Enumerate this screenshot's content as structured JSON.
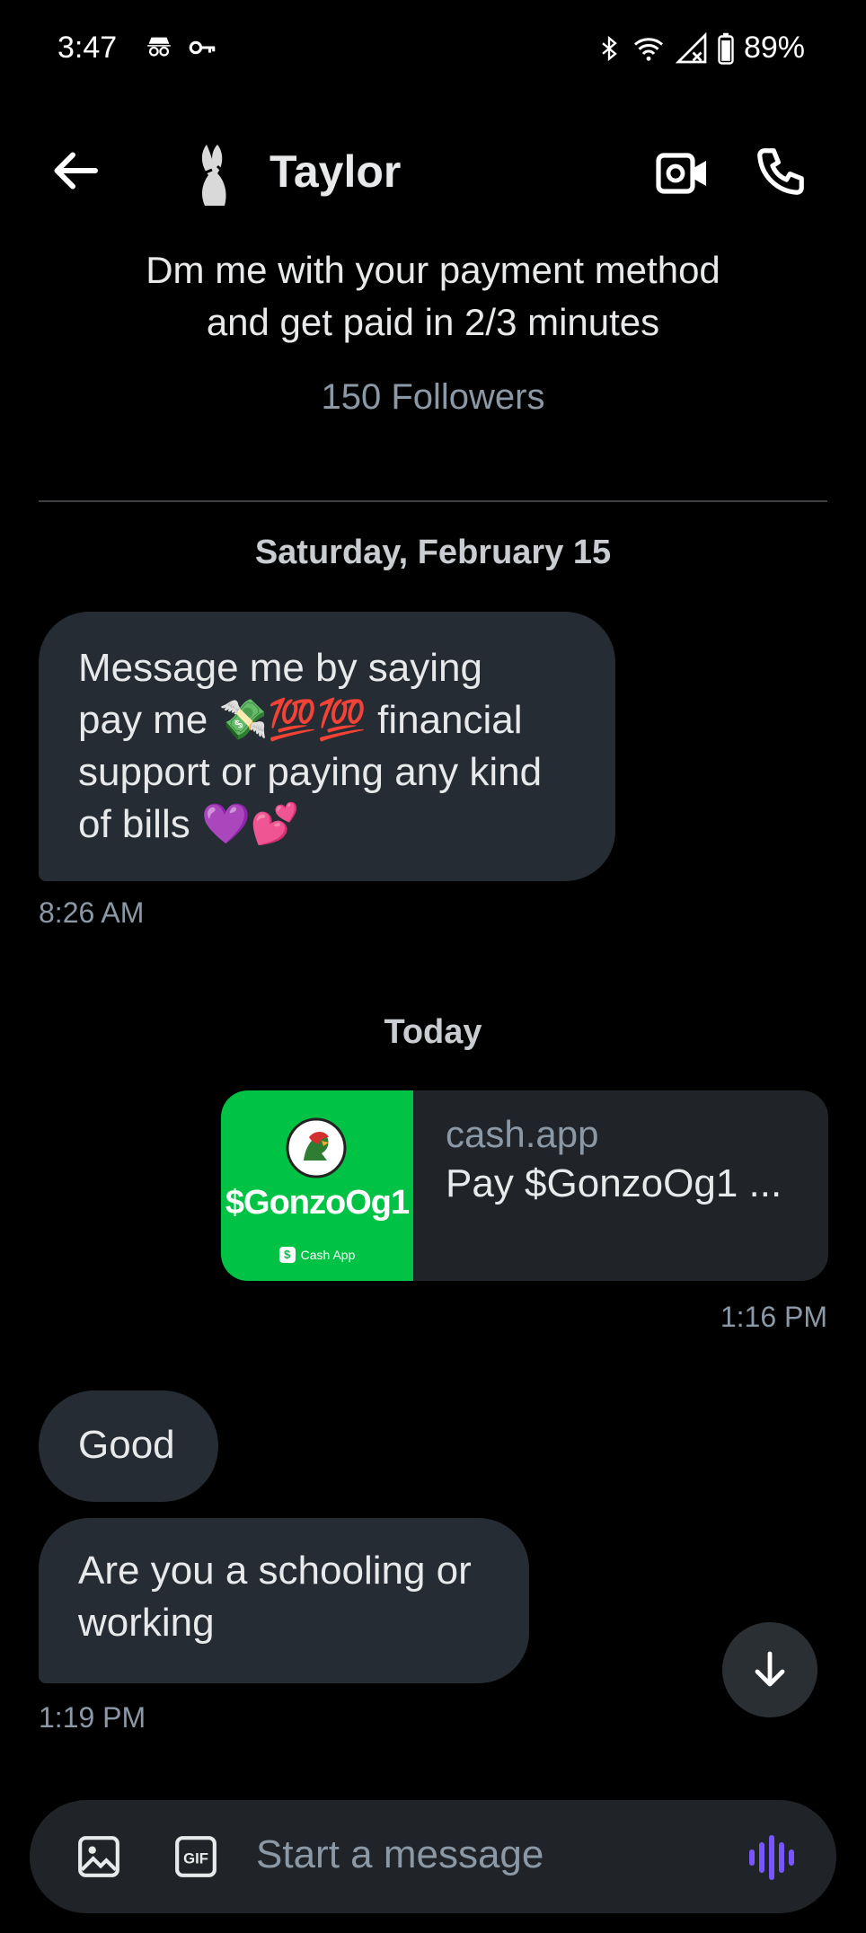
{
  "status_bar": {
    "time": "3:47",
    "battery": "89%"
  },
  "header": {
    "name": "Taylor"
  },
  "profile": {
    "bio_line1": "Dm me with your payment method",
    "bio_line2": "and get paid in 2/3 minutes",
    "followers": "150 Followers"
  },
  "messages": {
    "date1": "Saturday, February 15",
    "msg1": {
      "line1": "Message me by saying",
      "line2": "pay me 💸💯💯 financial",
      "line3": "support or paying any kind",
      "line4": "of bills 💜💕",
      "time": "8:26 AM"
    },
    "date2": "Today",
    "card": {
      "thumb_handle": "$GonzoOg1",
      "thumb_brand": "Cash App",
      "domain": "cash.app",
      "title": "Pay $GonzoOg1 ...",
      "time": "1:16 PM"
    },
    "msg2": {
      "text": "Good"
    },
    "msg3": {
      "line1": "Are you a schooling or",
      "line2": "working",
      "time": "1:19 PM"
    }
  },
  "composer": {
    "placeholder": "Start a message"
  },
  "colors": {
    "accent": "#7856ff",
    "cashapp_green": "#00c244",
    "bubble": "#252c33"
  }
}
